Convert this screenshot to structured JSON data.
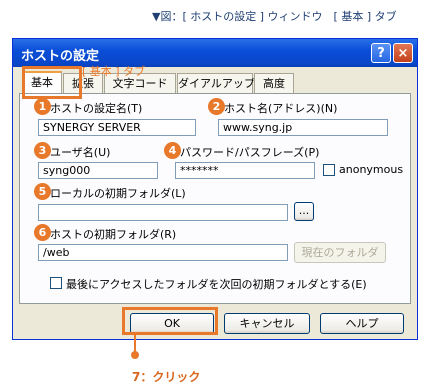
{
  "caption": "▼図：[ ホストの設定 ] ウィンドウ　[ 基本 ] タブ",
  "window": {
    "title": "ホストの設定",
    "help_label": "?",
    "close_label": "×"
  },
  "tabs": [
    "基本",
    "拡張",
    "文字コード",
    "ダイアルアップ",
    "高度"
  ],
  "tab_annotation": "[ 基本 ] タブ",
  "fields": {
    "setting_name": {
      "num": "1",
      "label": "ホストの設定名(T)",
      "value": "SYNERGY SERVER"
    },
    "host_name": {
      "num": "2",
      "label": "ホスト名(アドレス)(N)",
      "value": "www.syng.jp"
    },
    "user_name": {
      "num": "3",
      "label": "ユーザ名(U)",
      "value": "syng000"
    },
    "password": {
      "num": "4",
      "label": "パスワード/パスフレーズ(P)",
      "value": "*******"
    },
    "anonymous_label": "anonymous",
    "local_folder": {
      "num": "5",
      "label": "ローカルの初期フォルダ(L)",
      "value": "",
      "browse": "..."
    },
    "host_folder": {
      "num": "6",
      "label": "ホストの初期フォルダ(R)",
      "value": "/web",
      "current_button": "現在のフォルダ"
    },
    "last_folder_label": "最後にアクセスしたフォルダを次回の初期フォルダとする(E)"
  },
  "buttons": {
    "ok": "OK",
    "cancel": "キャンセル",
    "help": "ヘルプ"
  },
  "step7": "7：クリック"
}
